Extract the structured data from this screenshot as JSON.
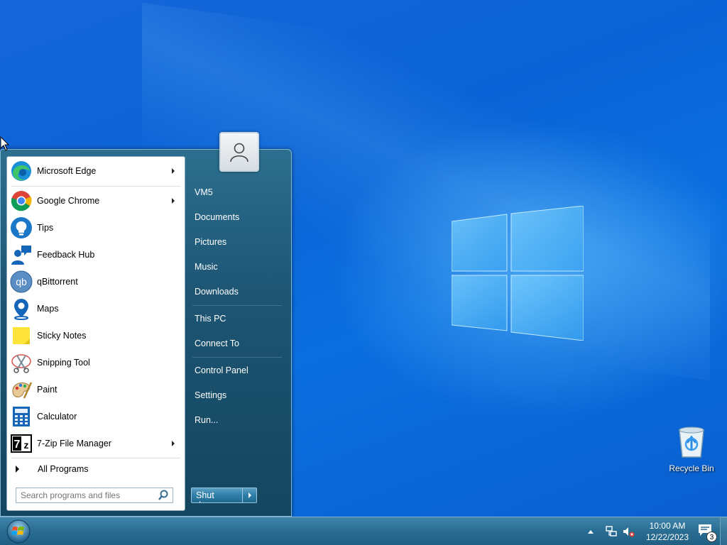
{
  "desktop": {
    "recycle_bin_label": "Recycle Bin"
  },
  "start_menu": {
    "programs": [
      {
        "label": "Microsoft Edge",
        "icon": "edge-icon",
        "has_submenu": true
      },
      {
        "label": "Google Chrome",
        "icon": "chrome-icon",
        "has_submenu": true
      },
      {
        "label": "Tips",
        "icon": "tips-icon",
        "has_submenu": false
      },
      {
        "label": "Feedback Hub",
        "icon": "feedback-hub-icon",
        "has_submenu": false
      },
      {
        "label": "qBittorrent",
        "icon": "qbittorrent-icon",
        "has_submenu": false
      },
      {
        "label": "Maps",
        "icon": "maps-icon",
        "has_submenu": false
      },
      {
        "label": "Sticky Notes",
        "icon": "sticky-notes-icon",
        "has_submenu": false
      },
      {
        "label": "Snipping Tool",
        "icon": "snipping-tool-icon",
        "has_submenu": false
      },
      {
        "label": "Paint",
        "icon": "paint-icon",
        "has_submenu": false
      },
      {
        "label": "Calculator",
        "icon": "calculator-icon",
        "has_submenu": false
      },
      {
        "label": "7-Zip File Manager",
        "icon": "7zip-icon",
        "has_submenu": true
      }
    ],
    "all_programs_label": "All Programs",
    "search_placeholder": "Search programs and files",
    "right_links": [
      {
        "label": "VM5"
      },
      {
        "label": "Documents"
      },
      {
        "label": "Pictures"
      },
      {
        "label": "Music"
      },
      {
        "label": "Downloads"
      },
      {
        "label": "This PC"
      },
      {
        "label": "Connect To"
      },
      {
        "label": "Control Panel"
      },
      {
        "label": "Settings"
      },
      {
        "label": "Run..."
      }
    ],
    "shutdown_label": "Shut down"
  },
  "taskbar": {
    "clock_time": "10:00 AM",
    "clock_date": "12/22/2023",
    "notification_count": "3"
  },
  "colors": {
    "desktop_blue": "#0a63d6",
    "start_menu_panel": "#1d5573",
    "taskbar": "#2a6d93"
  }
}
